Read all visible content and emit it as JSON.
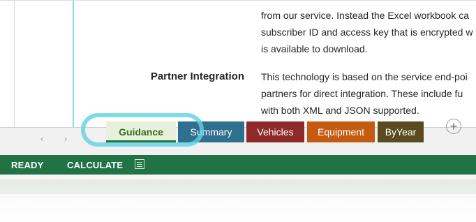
{
  "sheet": {
    "lines": [
      "from our service.  Instead the Excel workbook ca",
      "subscriber ID and access key that is encrypted w",
      "is available to download.",
      "This technology is based on the service end-poi",
      "partners for direct integration.  These include fu",
      "with both XML and JSON supported."
    ],
    "row_label": "Partner Integration"
  },
  "tabs": [
    {
      "label": "Guidance",
      "color": "#e6f0db",
      "active": true
    },
    {
      "label": "Summary",
      "color": "#2f6f8f",
      "active": false
    },
    {
      "label": "Vehicles",
      "color": "#8e2a2a",
      "active": false
    },
    {
      "label": "Equipment",
      "color": "#c55a11",
      "active": false
    },
    {
      "label": "ByYear",
      "color": "#5b4a1f",
      "active": false
    }
  ],
  "add_tab_label": "+",
  "status": {
    "ready": "READY",
    "calculate": "CALCULATE"
  },
  "colors": {
    "status_bar": "#217346",
    "highlight": "#62d2e0"
  }
}
